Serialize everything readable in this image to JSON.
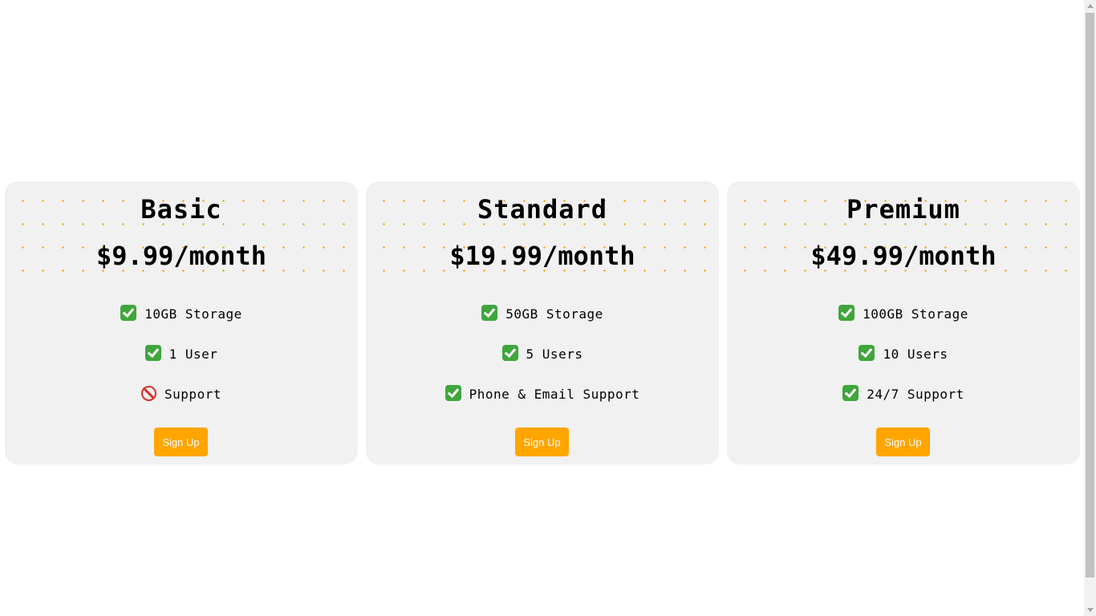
{
  "accent_color": "#ffa500",
  "check_icon": "check-mark-button-icon",
  "no_icon": "prohibited-icon",
  "plans": [
    {
      "name": "Basic",
      "price": "$9.99/month",
      "features": [
        {
          "icon": "check",
          "text": "10GB Storage"
        },
        {
          "icon": "check",
          "text": "1 User"
        },
        {
          "icon": "no",
          "text": "Support"
        }
      ],
      "button_label": "Sign Up"
    },
    {
      "name": "Standard",
      "price": "$19.99/month",
      "features": [
        {
          "icon": "check",
          "text": "50GB Storage"
        },
        {
          "icon": "check",
          "text": "5 Users"
        },
        {
          "icon": "check",
          "text": "Phone & Email Support"
        }
      ],
      "button_label": "Sign Up"
    },
    {
      "name": "Premium",
      "price": "$49.99/month",
      "features": [
        {
          "icon": "check",
          "text": "100GB Storage"
        },
        {
          "icon": "check",
          "text": "10 Users"
        },
        {
          "icon": "check",
          "text": "24/7 Support"
        }
      ],
      "button_label": "Sign Up"
    }
  ]
}
